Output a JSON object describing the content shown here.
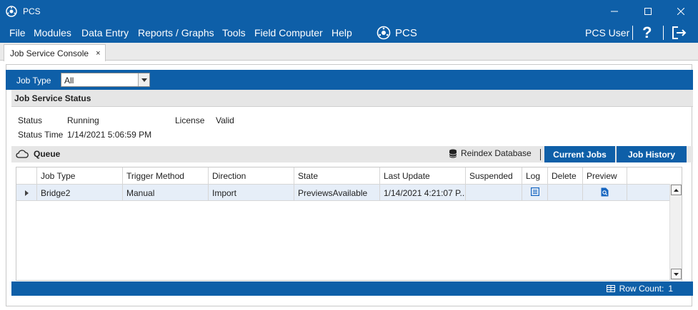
{
  "window": {
    "title": "PCS",
    "controls": [
      "minimize",
      "maximize",
      "close"
    ]
  },
  "menubar": {
    "items": [
      "File",
      "Modules",
      "Data Entry",
      "Reports / Graphs",
      "Tools",
      "Field Computer",
      "Help"
    ],
    "brand": "PCS",
    "user": "PCS User",
    "help_label": "?"
  },
  "tabs": [
    {
      "label": "Job Service Console",
      "close": "×"
    }
  ],
  "jobtype": {
    "label": "Job Type",
    "value": "All"
  },
  "status": {
    "title": "Job Service Status",
    "status_label": "Status",
    "status_value": "Running",
    "license_label": "License",
    "license_value": "Valid",
    "time_label": "Status Time",
    "time_value": "1/14/2021 5:06:59 PM"
  },
  "queue": {
    "title": "Queue",
    "reindex_label": "Reindex Database",
    "current_jobs": "Current Jobs",
    "job_history": "Job History"
  },
  "grid": {
    "columns": [
      "Job Type",
      "Trigger Method",
      "Direction",
      "State",
      "Last Update",
      "Suspended",
      "Log",
      "Delete",
      "Preview"
    ],
    "rows": [
      {
        "job_type": "Bridge2",
        "trigger": "Manual",
        "direction": "Import",
        "state": "PreviewsAvailable",
        "last_update": "1/14/2021 4:21:07 P...",
        "suspended": ""
      }
    ]
  },
  "footer": {
    "row_count_label": "Row Count:",
    "row_count": "1"
  },
  "colors": {
    "accent": "#0e5fa8",
    "header_gray": "#e6e6e6",
    "row_selected": "#e6eef8"
  }
}
